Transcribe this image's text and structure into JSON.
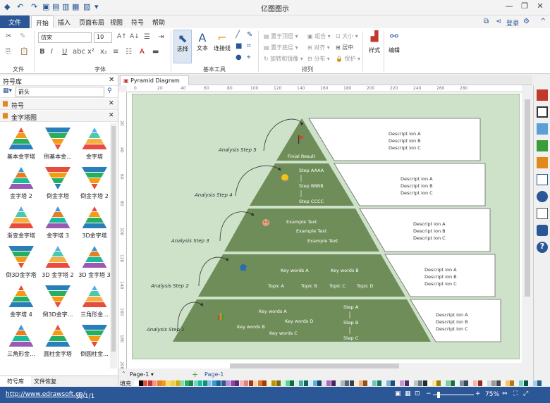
{
  "app": {
    "title": "亿图图示"
  },
  "ribbon_tabs": [
    "文件",
    "开始",
    "插入",
    "页面布局",
    "视图",
    "符号",
    "帮助"
  ],
  "account": {
    "login": "登录"
  },
  "ribbon": {
    "font_name": "仿宋",
    "font_size": "10",
    "tool_select": "选择",
    "tool_text": "文本",
    "tool_connector": "连接线",
    "arrange": {
      "bring_front": "置于顶层",
      "send_back": "置于底层",
      "rotate": "旋转和镜像",
      "group": "组合",
      "align": "对齐",
      "distribute": "分布",
      "size": "大小",
      "center": "居中",
      "protect": "保护"
    },
    "style": "样式",
    "edit": "编辑",
    "groups": {
      "file": "文件",
      "font": "字体",
      "basic_tools": "基本工具",
      "arrange": "排列"
    }
  },
  "library": {
    "title": "符号库",
    "search_value": "箭头",
    "sections": [
      "符号",
      "金字塔图"
    ],
    "shapes": [
      "基本金字塔",
      "倒基本金...",
      "金字塔",
      "金字塔 2",
      "倒金字塔",
      "倒金字塔 2",
      "渐变金字塔",
      "金字塔 3",
      "3D金字塔",
      "倒3D金字塔",
      "3D 金字塔 2",
      "3D 金字塔 3",
      "金字塔 4",
      "倒3D金字...",
      "三角形金...",
      "三角形金...",
      "圆柱金字塔",
      "倒圆柱金..."
    ],
    "bottom_tabs": [
      "符号库",
      "文件恢复"
    ]
  },
  "document": {
    "tab": "Pyramid Diagram"
  },
  "ruler": {
    "h": [
      "0",
      "20",
      "40",
      "60",
      "80",
      "100",
      "120",
      "140",
      "160",
      "180",
      "200",
      "220",
      "240",
      "260",
      "280"
    ],
    "v": [
      "20",
      "40",
      "60",
      "80",
      "100",
      "120",
      "140",
      "160",
      "180",
      "200"
    ]
  },
  "diagram": {
    "steps": [
      "Analysis Step 5",
      "Analysis Step 4",
      "Analysis Step 3",
      "Analysis Step 2",
      "Analysis Step 1"
    ],
    "tier1": {
      "text": "Finial Result"
    },
    "tier2": {
      "items": [
        "Step AAAA",
        "Step BBBB",
        "Step CCCC"
      ]
    },
    "tier3": {
      "items": [
        "Example Text",
        "Example Text",
        "Example Text"
      ]
    },
    "tier4": {
      "items": [
        "Key words A",
        "Key words B",
        "Topic A",
        "Topic B",
        "Topic C",
        "Topic D"
      ]
    },
    "tier5": {
      "items": [
        "Key words A",
        "Key words B",
        "Key words D",
        "Key words C",
        "Step A",
        "Step B",
        "Step C"
      ]
    },
    "desc": [
      "Descript ion A",
      "Descript ion B",
      "Descript ion C"
    ],
    "colors": {
      "tier": "#6f8d59",
      "page": "#cde2c9",
      "box": "#ffffff"
    }
  },
  "pages": {
    "current": "Page-1",
    "tab": "Page-1"
  },
  "fill_label": "填充",
  "status": {
    "url": "http://www.edrawsoft.cn/",
    "page": "页 1/1",
    "zoom": "75%"
  }
}
